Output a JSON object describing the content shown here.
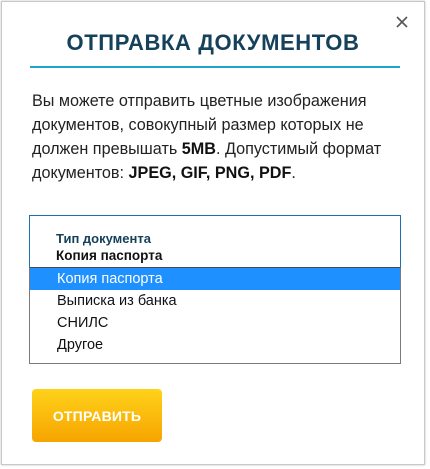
{
  "dialog": {
    "title": "ОТПРАВКА ДОКУМЕНТОВ",
    "close_icon": "close-icon"
  },
  "description": {
    "part1": "Вы можете отправить цветные изображения документов, совокупный размер которых не должен превышать ",
    "size": "5MB",
    "part2": ". Допустимый формат документов: ",
    "formats": "JPEG, GIF, PNG, PDF",
    "part3": "."
  },
  "document_type": {
    "label": "Тип документа",
    "value": "Копия паспорта",
    "options": [
      "Копия паспорта",
      "Выписка из банка",
      "СНИЛС",
      "Другое"
    ],
    "selected_index": 0
  },
  "submit_label": "ОТПРАВИТЬ",
  "colors": {
    "title": "#15415b",
    "accent_line": "#1ea6c9",
    "selected_option": "#1e90ff",
    "button_top": "#ffd21a",
    "button_bottom": "#f7a400"
  }
}
